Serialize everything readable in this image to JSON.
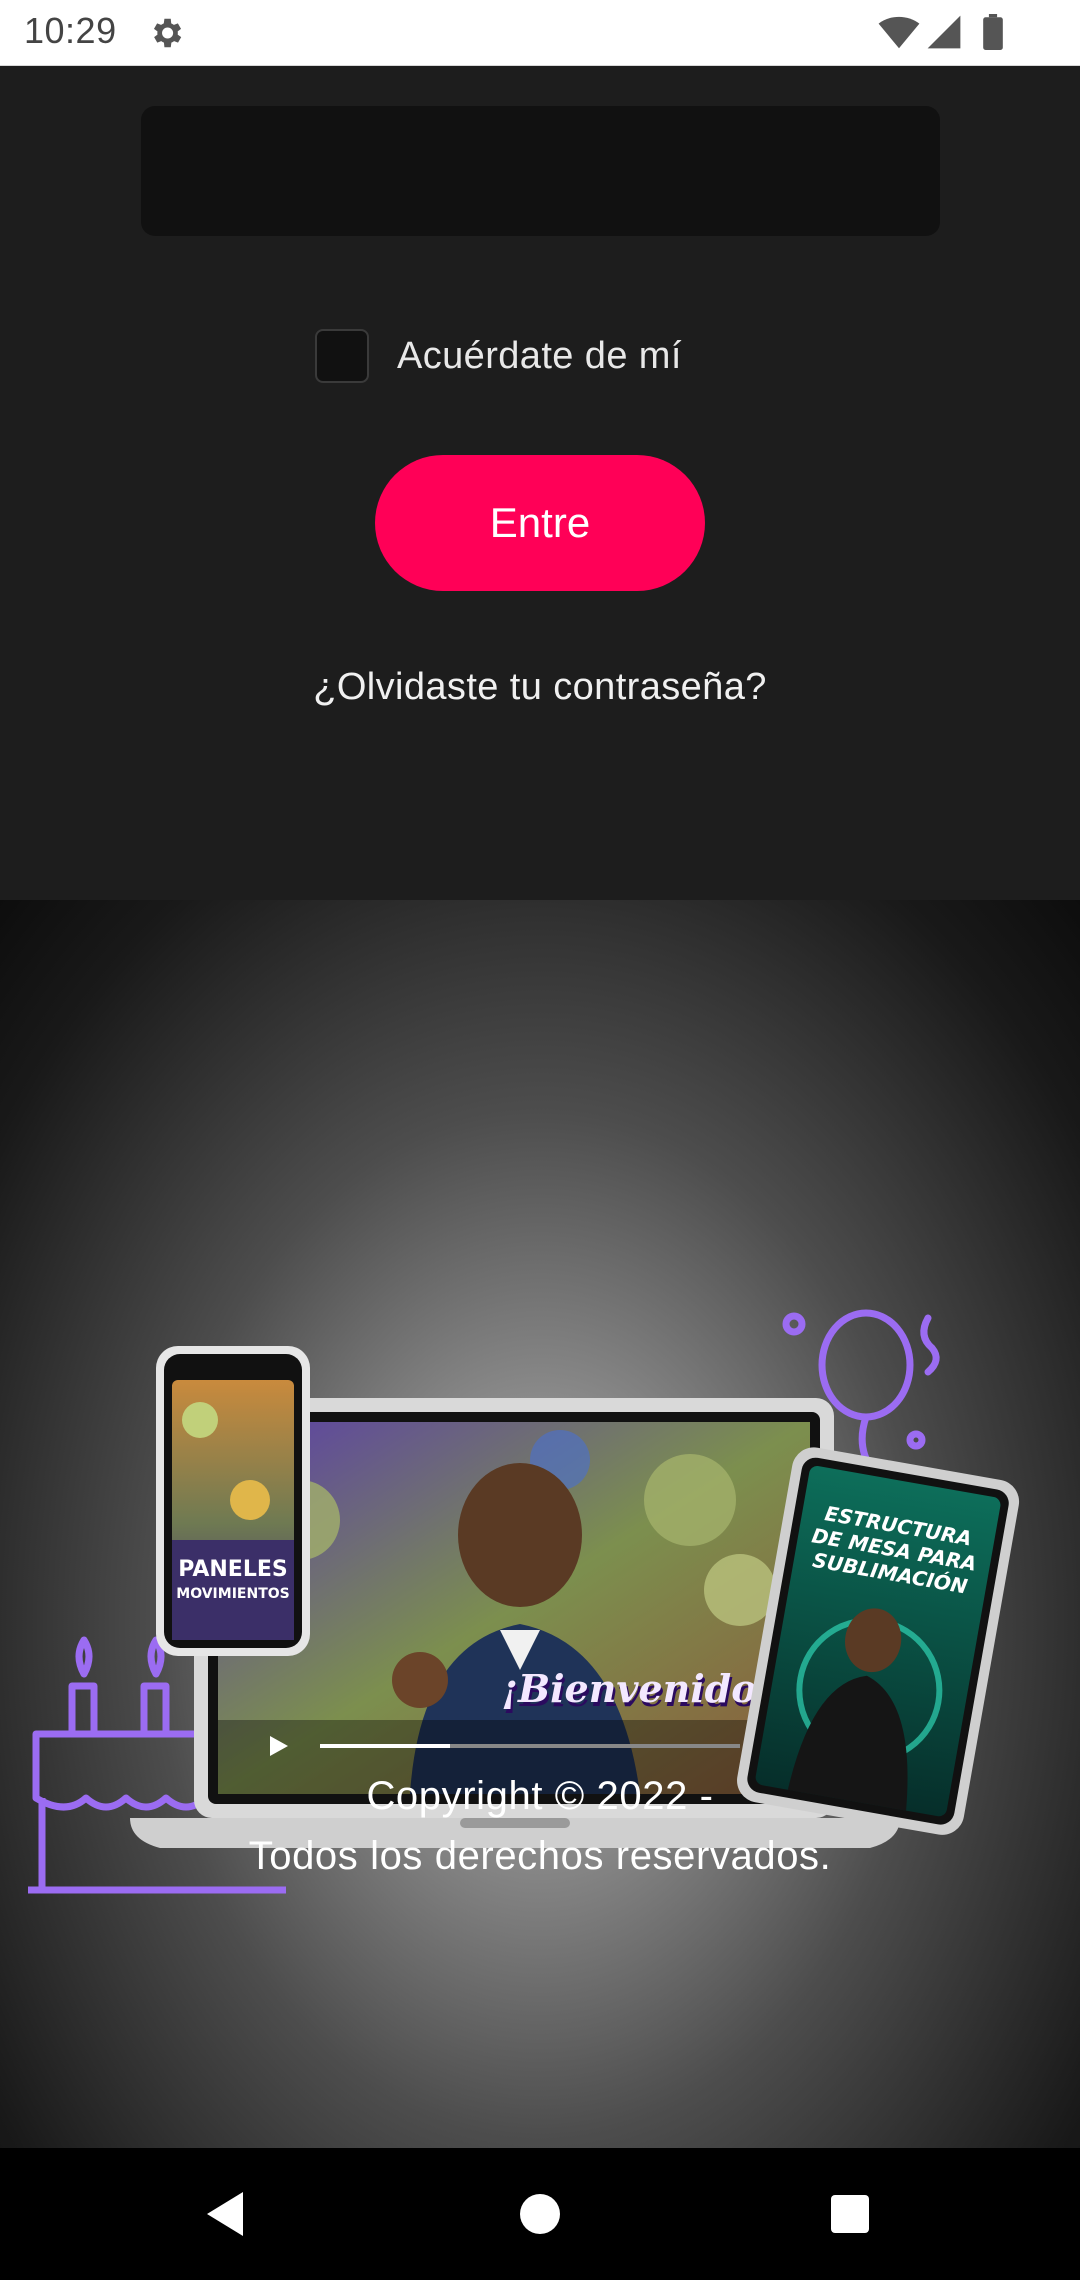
{
  "status_bar": {
    "time": "10:29",
    "icons": [
      "gear-icon",
      "wifi-icon",
      "signal-icon",
      "battery-icon"
    ]
  },
  "login_form": {
    "password_value": "",
    "remember_label": "Acuérdate de mí",
    "remember_checked": false,
    "submit_label": "Entre",
    "forgot_label": "¿Olvidaste tu contraseña?"
  },
  "promo": {
    "phone_title_line1": "PANELES",
    "phone_title_line2": "MOVIMIENTOS",
    "laptop_caption": "¡Bienvenidos!",
    "tablet_title_line1": "ESTRUCTURA",
    "tablet_title_line2": "DE MESA PARA",
    "tablet_title_line3": "SUBLIMACIÓN"
  },
  "footer": {
    "copyright_line1": "Copyright © 2022 -",
    "copyright_line2": "Todos los derechos reservados."
  },
  "nav_bar": {
    "buttons": [
      "back-icon",
      "home-icon",
      "recents-icon"
    ]
  },
  "colors": {
    "accent": "#ff0057",
    "background": "#1d1d1d",
    "field_background": "#111111",
    "neon_purple": "#9b6cf2"
  }
}
